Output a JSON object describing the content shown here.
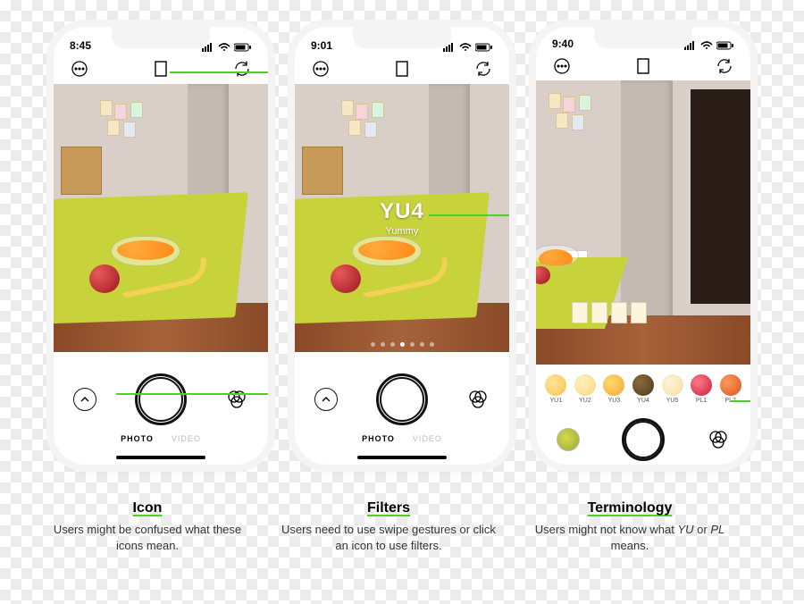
{
  "phone1": {
    "time": "8:45",
    "toolbar": {
      "more": "more-icon",
      "aspect": "aspect-icon",
      "flip": "flip-icon"
    },
    "controls": {
      "left_icon": "collapse-icon",
      "right_icon": "filters-icon"
    },
    "modes": {
      "photo": "PHOTO",
      "video": "VIDEO"
    }
  },
  "phone2": {
    "time": "9:01",
    "filter": {
      "code": "YU4",
      "name": "Yummy"
    },
    "modes": {
      "photo": "PHOTO",
      "video": "VIDEO"
    }
  },
  "phone3": {
    "time": "9:40",
    "filters": [
      {
        "id": "YU1"
      },
      {
        "id": "YU2"
      },
      {
        "id": "YU3"
      },
      {
        "id": "YU4"
      },
      {
        "id": "YU5"
      },
      {
        "id": "PL1"
      },
      {
        "id": "PL2"
      }
    ]
  },
  "captions": {
    "icon": {
      "title": "Icon",
      "body": "Users might be confused what these icons mean."
    },
    "filters": {
      "title": "Filters",
      "body": "Users need to use swipe gestures or click an icon to use filters."
    },
    "terminology": {
      "title": "Terminology",
      "body_pre": "Users might not know what ",
      "em1": "YU",
      "mid": " or ",
      "em2": "PL",
      "body_post": " means."
    }
  }
}
